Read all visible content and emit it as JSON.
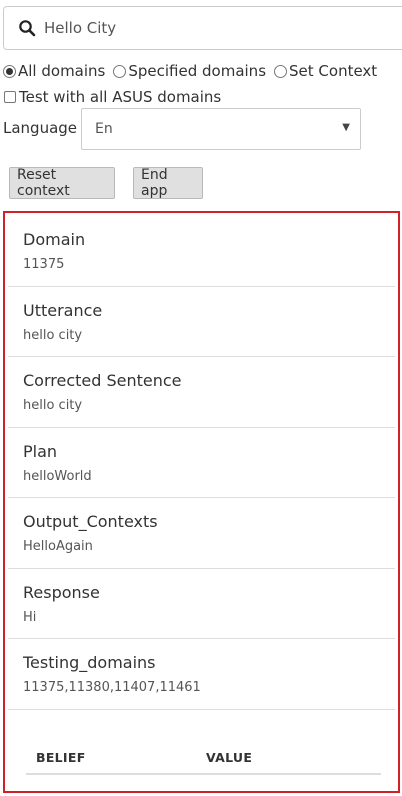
{
  "search": {
    "value": "Hello City",
    "icon": "search-icon"
  },
  "domain_options": [
    {
      "label": "All domains",
      "checked": true
    },
    {
      "label": "Specified domains",
      "checked": false
    },
    {
      "label": "Set Context",
      "checked": false
    }
  ],
  "test_all": {
    "label": "Test with all ASUS domains",
    "checked": false
  },
  "language": {
    "label": "Language",
    "selected": "En"
  },
  "buttons": {
    "reset": "Reset context",
    "end": "End app"
  },
  "results": [
    {
      "title": "Domain",
      "value": "11375"
    },
    {
      "title": "Utterance",
      "value": "hello city"
    },
    {
      "title": "Corrected Sentence",
      "value": "hello city"
    },
    {
      "title": "Plan",
      "value": "helloWorld"
    },
    {
      "title": "Output_Contexts",
      "value": "HelloAgain"
    },
    {
      "title": "Response",
      "value": "Hi"
    },
    {
      "title": "Testing_domains",
      "value": "11375,11380,11407,11461"
    }
  ],
  "belief_table": {
    "headers": [
      "BELIEF",
      "VALUE"
    ]
  },
  "colors": {
    "highlight_border": "#d0202a",
    "button_bg": "#e0e0e0"
  }
}
